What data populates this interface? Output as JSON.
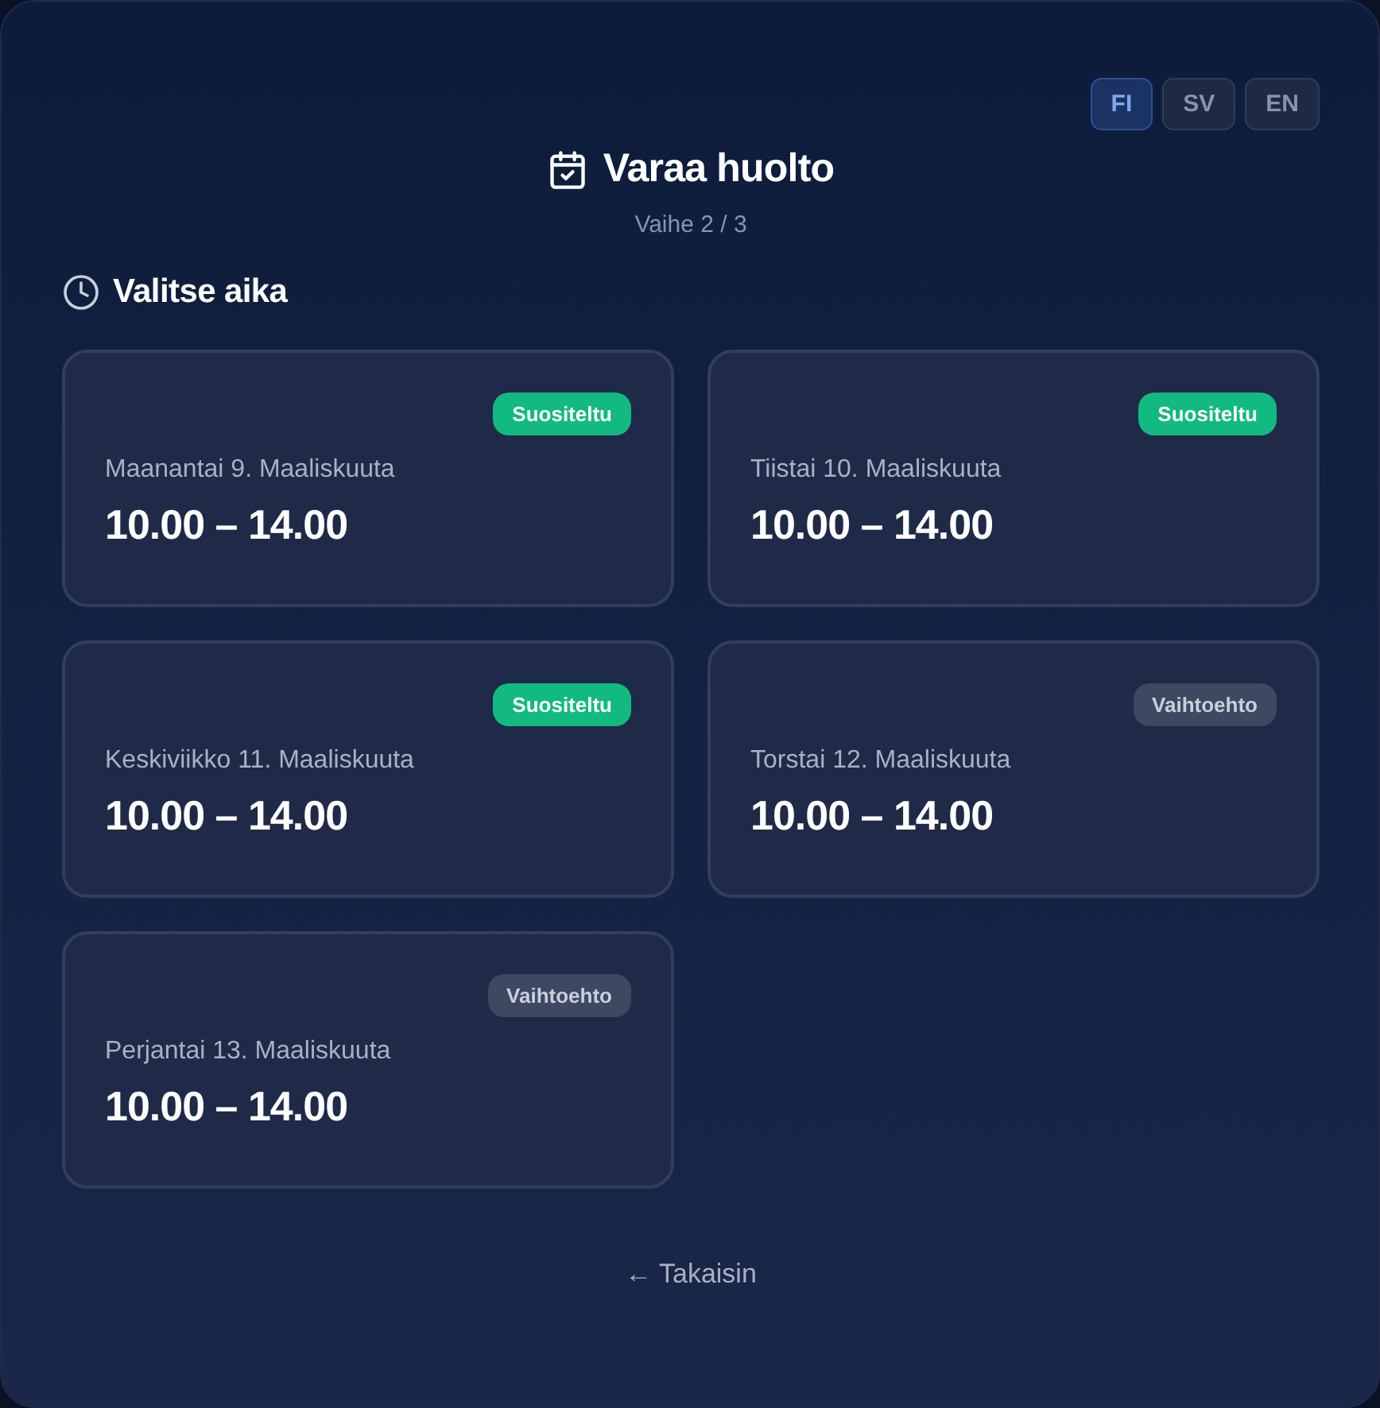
{
  "languages": [
    {
      "label": "FI",
      "selected": true
    },
    {
      "label": "SV",
      "selected": false
    },
    {
      "label": "EN",
      "selected": false
    }
  ],
  "header": {
    "title": "Varaa huolto",
    "step": "Vaihe 2 / 3"
  },
  "section": {
    "title": "Valitse aika"
  },
  "slots": [
    {
      "badge": {
        "kind": "recommended",
        "label": "Suositeltu"
      },
      "date": "Maanantai 9. Maaliskuuta",
      "time": "10.00 – 14.00"
    },
    {
      "badge": {
        "kind": "recommended",
        "label": "Suositeltu"
      },
      "date": "Tiistai 10. Maaliskuuta",
      "time": "10.00 – 14.00"
    },
    {
      "badge": {
        "kind": "recommended",
        "label": "Suositeltu"
      },
      "date": "Keskiviikko 11. Maaliskuuta",
      "time": "10.00 – 14.00"
    },
    {
      "badge": {
        "kind": "alternative",
        "label": "Vaihtoehto"
      },
      "date": "Torstai 12. Maaliskuuta",
      "time": "10.00 – 14.00"
    },
    {
      "badge": {
        "kind": "alternative",
        "label": "Vaihtoehto"
      },
      "date": "Perjantai 13. Maaliskuuta",
      "time": "10.00 – 14.00"
    }
  ],
  "back": {
    "label": "← Takaisin"
  }
}
